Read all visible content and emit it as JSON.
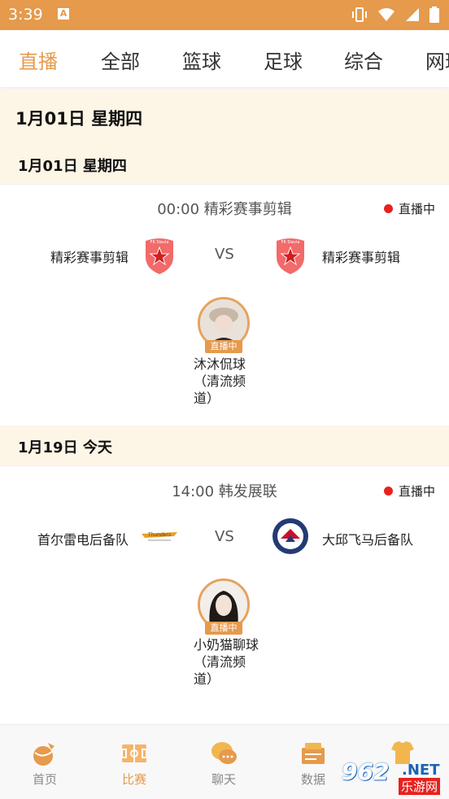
{
  "status_bar": {
    "time": "3:39",
    "notification_letter": "A"
  },
  "tabs": [
    {
      "label": "直播",
      "active": true
    },
    {
      "label": "全部",
      "active": false
    },
    {
      "label": "篮球",
      "active": false
    },
    {
      "label": "足球",
      "active": false
    },
    {
      "label": "综合",
      "active": false
    },
    {
      "label": "网球",
      "active": false
    }
  ],
  "date_header": "1月01日  星期四",
  "sections": [
    {
      "header": "1月01日   星期四",
      "match": {
        "title": "00:00  精彩赛事剪辑",
        "live_label": "直播中",
        "home_team": "精彩赛事剪辑",
        "away_team": "精彩赛事剪辑",
        "vs": "VS",
        "anchor": {
          "tag": "直播中",
          "name": "沐沐侃球（清流频道）"
        }
      }
    },
    {
      "header": "1月19日   今天",
      "match": {
        "title": "14:00  韩发展联",
        "live_label": "直播中",
        "home_team": "首尔雷电后备队",
        "away_team": "大邱飞马后备队",
        "vs": "VS",
        "anchor": {
          "tag": "直播中",
          "name": "小奶猫聊球（清流频道）"
        }
      }
    }
  ],
  "bottom_nav": [
    {
      "label": "首页",
      "icon": "home-icon",
      "active": false
    },
    {
      "label": "比赛",
      "icon": "match-icon",
      "active": true
    },
    {
      "label": "聊天",
      "icon": "chat-icon",
      "active": false
    },
    {
      "label": "数据",
      "icon": "data-icon",
      "active": false
    },
    {
      "label": "",
      "icon": "profile-icon",
      "active": false
    }
  ],
  "watermark": {
    "number": "962",
    "net": ".NET",
    "sub": "乐游网"
  },
  "colors": {
    "accent": "#E59A4C",
    "live": "#E8211E",
    "section_bg": "#FDF5E6"
  }
}
